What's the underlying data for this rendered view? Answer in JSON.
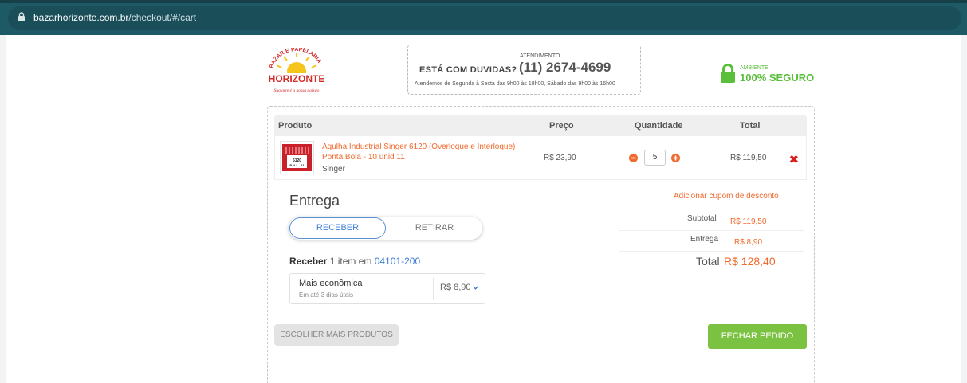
{
  "browser": {
    "url_domain": "bazarhorizonte.com.br",
    "url_path": "/checkout/#/cart"
  },
  "header": {
    "logo": {
      "arc_text": "BAZAR E PAPELARIA",
      "name": "HORIZONTE",
      "tagline": "Sua arte é a nossa paixão"
    },
    "support": {
      "question": "ESTÁ COM DUVIDAS?",
      "label": "ATENDIMENTO",
      "phone": "(11) 2674-4699",
      "hours": "Atendemos de Segunda à Sexta das 9h00 às 18h00, Sábado das 9h00 às 16h00"
    },
    "secure": {
      "label": "AMBIENTE",
      "value": "100% SEGURO"
    }
  },
  "cart": {
    "columns": [
      "Produto",
      "Preço",
      "Quantidade",
      "Total"
    ],
    "items": [
      {
        "name": "Agulha Industrial Singer 6120 (Overloque e Interloque) Ponta Bola - 10 unid 11",
        "brand": "Singer",
        "thumb_text": [
          "6120",
          "BALL - 11"
        ],
        "price": "R$ 23,90",
        "quantity": "5",
        "total": "R$ 119,50"
      }
    ]
  },
  "delivery": {
    "title": "Entrega",
    "tabs": [
      "RECEBER",
      "RETIRAR"
    ],
    "active_tab": "RECEBER",
    "summary_bold": "Receber",
    "summary_count": "1 item em",
    "cep": "04101-200",
    "option_name": "Mais econômica",
    "option_days": "Em até 3 dias úteis",
    "option_price": "R$ 8,90"
  },
  "summary": {
    "coupon_link": "Adicionar cupom de desconto",
    "subtotal_label": "Subtotal",
    "subtotal_value": "R$ 119,50",
    "shipping_label": "Entrega",
    "shipping_value": "R$ 8,90",
    "total_label": "Total",
    "total_value": "R$ 128,40"
  },
  "actions": {
    "more_products": "ESCOLHER MAIS PRODUTOS",
    "finish": "FECHAR PEDIDO"
  },
  "colors": {
    "browser_bar": "#1d5a66",
    "accent_orange": "#f06a2d",
    "link_blue": "#3b7dd8",
    "secure_green": "#5abf3a",
    "finish_green": "#7cc242",
    "remove_red": "#d62020"
  }
}
